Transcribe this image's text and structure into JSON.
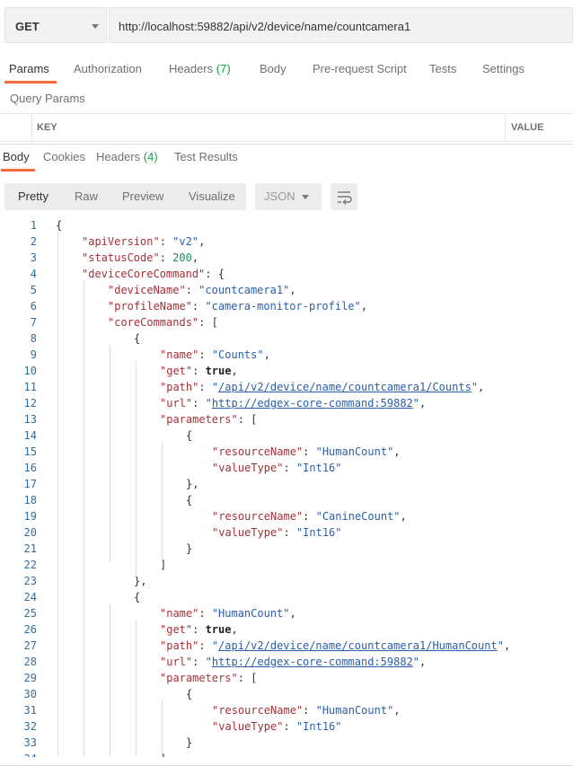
{
  "request": {
    "method": "GET",
    "url": "http://localhost:59882/api/v2/device/name/countcamera1"
  },
  "request_tabs": [
    {
      "label": "Params",
      "count": ""
    },
    {
      "label": "Authorization",
      "count": ""
    },
    {
      "label": "Headers",
      "count": "(7)"
    },
    {
      "label": "Body",
      "count": ""
    },
    {
      "label": "Pre-request Script",
      "count": ""
    },
    {
      "label": "Tests",
      "count": ""
    },
    {
      "label": "Settings",
      "count": ""
    }
  ],
  "query_params": {
    "title": "Query Params",
    "key_header": "KEY",
    "value_header": "VALUE"
  },
  "response_tabs": [
    {
      "label": "Body",
      "count": ""
    },
    {
      "label": "Cookies",
      "count": ""
    },
    {
      "label": "Headers",
      "count": "(4)"
    },
    {
      "label": "Test Results",
      "count": ""
    }
  ],
  "view_formats": [
    "Pretty",
    "Raw",
    "Preview",
    "Visualize"
  ],
  "language_select": "JSON",
  "colors": {
    "accent": "#f26b3a",
    "count_green": "#16a34a",
    "key_red": "#a3313a",
    "string_blue": "#2a5fa8",
    "number_green": "#1e8e6e"
  },
  "response_lines": [
    [
      {
        "t": "p",
        "v": "{"
      }
    ],
    [
      {
        "t": "k",
        "v": "\"apiVersion\""
      },
      {
        "t": "p",
        "v": ": "
      },
      {
        "t": "s",
        "v": "\"v2\""
      },
      {
        "t": "p",
        "v": ","
      }
    ],
    [
      {
        "t": "k",
        "v": "\"statusCode\""
      },
      {
        "t": "p",
        "v": ": "
      },
      {
        "t": "n",
        "v": "200"
      },
      {
        "t": "p",
        "v": ","
      }
    ],
    [
      {
        "t": "k",
        "v": "\"deviceCoreCommand\""
      },
      {
        "t": "p",
        "v": ": {"
      }
    ],
    [
      {
        "t": "k",
        "v": "\"deviceName\""
      },
      {
        "t": "p",
        "v": ": "
      },
      {
        "t": "s",
        "v": "\"countcamera1\""
      },
      {
        "t": "p",
        "v": ","
      }
    ],
    [
      {
        "t": "k",
        "v": "\"profileName\""
      },
      {
        "t": "p",
        "v": ": "
      },
      {
        "t": "s",
        "v": "\"camera-monitor-profile\""
      },
      {
        "t": "p",
        "v": ","
      }
    ],
    [
      {
        "t": "k",
        "v": "\"coreCommands\""
      },
      {
        "t": "p",
        "v": ": ["
      }
    ],
    [
      {
        "t": "p",
        "v": "{"
      }
    ],
    [
      {
        "t": "k",
        "v": "\"name\""
      },
      {
        "t": "p",
        "v": ": "
      },
      {
        "t": "s",
        "v": "\"Counts\""
      },
      {
        "t": "p",
        "v": ","
      }
    ],
    [
      {
        "t": "k",
        "v": "\"get\""
      },
      {
        "t": "p",
        "v": ": "
      },
      {
        "t": "b",
        "v": "true"
      },
      {
        "t": "p",
        "v": ","
      }
    ],
    [
      {
        "t": "k",
        "v": "\"path\""
      },
      {
        "t": "p",
        "v": ": "
      },
      {
        "t": "s",
        "v": "\""
      },
      {
        "t": "u",
        "v": "/api/v2/device/name/countcamera1/Counts"
      },
      {
        "t": "s",
        "v": "\""
      },
      {
        "t": "p",
        "v": ","
      }
    ],
    [
      {
        "t": "k",
        "v": "\"url\""
      },
      {
        "t": "p",
        "v": ": "
      },
      {
        "t": "s",
        "v": "\""
      },
      {
        "t": "u",
        "v": "http://edgex-core-command:59882"
      },
      {
        "t": "s",
        "v": "\""
      },
      {
        "t": "p",
        "v": ","
      }
    ],
    [
      {
        "t": "k",
        "v": "\"parameters\""
      },
      {
        "t": "p",
        "v": ": ["
      }
    ],
    [
      {
        "t": "p",
        "v": "{"
      }
    ],
    [
      {
        "t": "k",
        "v": "\"resourceName\""
      },
      {
        "t": "p",
        "v": ": "
      },
      {
        "t": "s",
        "v": "\"HumanCount\""
      },
      {
        "t": "p",
        "v": ","
      }
    ],
    [
      {
        "t": "k",
        "v": "\"valueType\""
      },
      {
        "t": "p",
        "v": ": "
      },
      {
        "t": "s",
        "v": "\"Int16\""
      }
    ],
    [
      {
        "t": "p",
        "v": "},"
      }
    ],
    [
      {
        "t": "p",
        "v": "{"
      }
    ],
    [
      {
        "t": "k",
        "v": "\"resourceName\""
      },
      {
        "t": "p",
        "v": ": "
      },
      {
        "t": "s",
        "v": "\"CanineCount\""
      },
      {
        "t": "p",
        "v": ","
      }
    ],
    [
      {
        "t": "k",
        "v": "\"valueType\""
      },
      {
        "t": "p",
        "v": ": "
      },
      {
        "t": "s",
        "v": "\"Int16\""
      }
    ],
    [
      {
        "t": "p",
        "v": "}"
      }
    ],
    [
      {
        "t": "p",
        "v": "]"
      }
    ],
    [
      {
        "t": "p",
        "v": "},"
      }
    ],
    [
      {
        "t": "p",
        "v": "{"
      }
    ],
    [
      {
        "t": "k",
        "v": "\"name\""
      },
      {
        "t": "p",
        "v": ": "
      },
      {
        "t": "s",
        "v": "\"HumanCount\""
      },
      {
        "t": "p",
        "v": ","
      }
    ],
    [
      {
        "t": "k",
        "v": "\"get\""
      },
      {
        "t": "p",
        "v": ": "
      },
      {
        "t": "b",
        "v": "true"
      },
      {
        "t": "p",
        "v": ","
      }
    ],
    [
      {
        "t": "k",
        "v": "\"path\""
      },
      {
        "t": "p",
        "v": ": "
      },
      {
        "t": "s",
        "v": "\""
      },
      {
        "t": "u",
        "v": "/api/v2/device/name/countcamera1/HumanCount"
      },
      {
        "t": "s",
        "v": "\""
      },
      {
        "t": "p",
        "v": ","
      }
    ],
    [
      {
        "t": "k",
        "v": "\"url\""
      },
      {
        "t": "p",
        "v": ": "
      },
      {
        "t": "s",
        "v": "\""
      },
      {
        "t": "u",
        "v": "http://edgex-core-command:59882"
      },
      {
        "t": "s",
        "v": "\""
      },
      {
        "t": "p",
        "v": ","
      }
    ],
    [
      {
        "t": "k",
        "v": "\"parameters\""
      },
      {
        "t": "p",
        "v": ": ["
      }
    ],
    [
      {
        "t": "p",
        "v": "{"
      }
    ],
    [
      {
        "t": "k",
        "v": "\"resourceName\""
      },
      {
        "t": "p",
        "v": ": "
      },
      {
        "t": "s",
        "v": "\"HumanCount\""
      },
      {
        "t": "p",
        "v": ","
      }
    ],
    [
      {
        "t": "k",
        "v": "\"valueType\""
      },
      {
        "t": "p",
        "v": ": "
      },
      {
        "t": "s",
        "v": "\"Int16\""
      }
    ],
    [
      {
        "t": "p",
        "v": "}"
      }
    ],
    [
      {
        "t": "p",
        "v": "]"
      }
    ]
  ]
}
